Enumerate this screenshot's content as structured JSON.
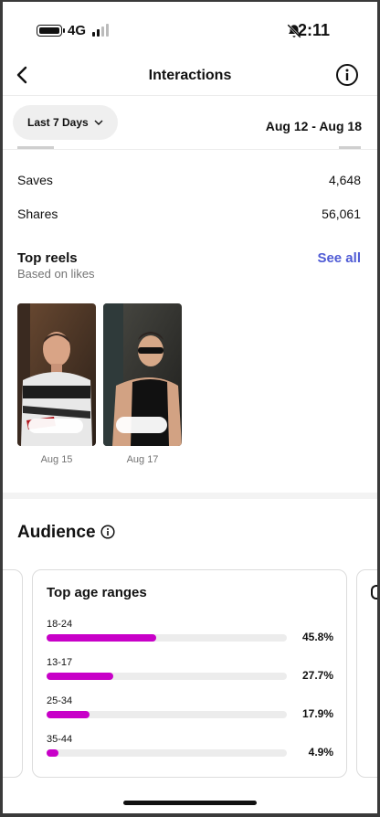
{
  "status": {
    "network": "4G",
    "time": "2:11"
  },
  "nav": {
    "title": "Interactions"
  },
  "filter": {
    "label": "Last 7 Days",
    "date_range": "Aug 12 - Aug 18"
  },
  "metrics": [
    {
      "label": "Saves",
      "value": "4,648"
    },
    {
      "label": "Shares",
      "value": "56,061"
    }
  ],
  "top_reels": {
    "title": "Top reels",
    "subtitle": "Based on likes",
    "see_all": "See all",
    "reels": [
      {
        "date": "Aug 15"
      },
      {
        "date": "Aug 17"
      }
    ]
  },
  "audience": {
    "title": "Audience",
    "card_title": "Top age ranges",
    "ranges": [
      {
        "label": "18-24",
        "value": "45.8%",
        "fraction": 0.458
      },
      {
        "label": "13-17",
        "value": "27.7%",
        "fraction": 0.277
      },
      {
        "label": "25-34",
        "value": "17.9%",
        "fraction": 0.179
      },
      {
        "label": "35-44",
        "value": "4.9%",
        "fraction": 0.049
      }
    ],
    "bar_color": "#c800c8",
    "prev_card_values": [
      "%",
      "%",
      "%",
      "%"
    ]
  },
  "colors": {
    "link": "#4f5bd5"
  }
}
